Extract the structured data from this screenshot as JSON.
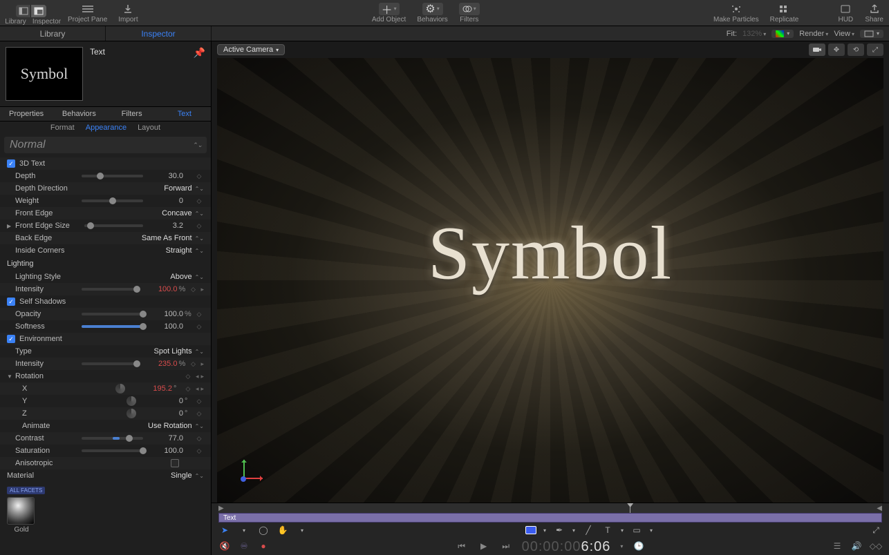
{
  "toolbar": {
    "left": {
      "library": "Library",
      "inspector": "Inspector",
      "project_pane": "Project Pane",
      "import": "Import"
    },
    "center": {
      "add_object": "Add Object",
      "behaviors": "Behaviors",
      "filters": "Filters"
    },
    "right": {
      "make_particles": "Make Particles",
      "replicate": "Replicate",
      "hud": "HUD",
      "share": "Share"
    }
  },
  "left_tabs": {
    "library": "Library",
    "inspector": "Inspector"
  },
  "view_controls": {
    "fit_label": "Fit:",
    "fit_value": "132%",
    "render": "Render",
    "view": "View"
  },
  "camera_menu": "Active Camera",
  "object_name": "Text",
  "thumbnail_text": "Symbol",
  "inspector_tabs": {
    "properties": "Properties",
    "behaviors": "Behaviors",
    "filters": "Filters",
    "text": "Text"
  },
  "text_subtabs": {
    "format": "Format",
    "appearance": "Appearance",
    "layout": "Layout"
  },
  "style_preview": "Normal",
  "params": {
    "three_d_text_label": "3D Text",
    "depth": {
      "label": "Depth",
      "value": "30.0"
    },
    "depth_direction": {
      "label": "Depth Direction",
      "value": "Forward"
    },
    "weight": {
      "label": "Weight",
      "value": "0"
    },
    "front_edge": {
      "label": "Front Edge",
      "value": "Concave"
    },
    "front_edge_size": {
      "label": "Front Edge Size",
      "value": "3.2"
    },
    "back_edge": {
      "label": "Back Edge",
      "value": "Same As Front"
    },
    "inside_corners": {
      "label": "Inside Corners",
      "value": "Straight"
    },
    "lighting_header": "Lighting",
    "lighting_style": {
      "label": "Lighting Style",
      "value": "Above"
    },
    "lighting_intensity": {
      "label": "Intensity",
      "value": "100.0",
      "unit": "%"
    },
    "self_shadows_label": "Self Shadows",
    "opacity": {
      "label": "Opacity",
      "value": "100.0",
      "unit": "%"
    },
    "softness": {
      "label": "Softness",
      "value": "100.0"
    },
    "environment_label": "Environment",
    "env_type": {
      "label": "Type",
      "value": "Spot Lights"
    },
    "env_intensity": {
      "label": "Intensity",
      "value": "235.0",
      "unit": "%"
    },
    "rotation_label": "Rotation",
    "rot_x": {
      "label": "X",
      "value": "195.2",
      "unit": "°"
    },
    "rot_y": {
      "label": "Y",
      "value": "0",
      "unit": "°"
    },
    "rot_z": {
      "label": "Z",
      "value": "0",
      "unit": "°"
    },
    "animate": {
      "label": "Animate",
      "value": "Use Rotation"
    },
    "contrast": {
      "label": "Contrast",
      "value": "77.0"
    },
    "saturation": {
      "label": "Saturation",
      "value": "100.0"
    },
    "anisotropic_label": "Anisotropic",
    "material_header": "Material",
    "material_mode": "Single",
    "all_facets": "ALL FACETS",
    "material_name": "Gold"
  },
  "canvas_text": "Symbol",
  "timeline": {
    "track_label": "Text",
    "time_prefix": "00:00:00",
    "time_frames": "6:06"
  }
}
